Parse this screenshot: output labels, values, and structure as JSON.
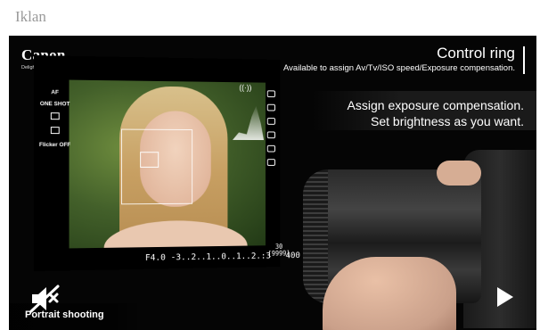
{
  "ad_label": "Iklan",
  "brand": {
    "name": "Canon",
    "tagline": "Delighting You Always"
  },
  "headline": {
    "title": "Control ring",
    "subtitle": "Available to assign Av/Tv/ISO speed/Exposure compensation."
  },
  "caption": {
    "line1": "Assign exposure compensation.",
    "line2": "Set brightness as you want."
  },
  "lcd": {
    "af_mode": "AF",
    "drive": "ONE SHOT",
    "flicker": "Flicker OFF",
    "aperture": "F4.0",
    "exposure_scale": "-3..2..1..0..1..2.:3",
    "iso": "400",
    "shots_top": "30",
    "shots_bottom": "[9999]"
  },
  "mode_label": "Portrait shooting",
  "controls": {
    "mute": "mute-icon",
    "play": "play-icon"
  },
  "colors": {
    "video_bg": "#050505",
    "text": "#ffffff",
    "ad_label": "#9a9a9a"
  }
}
